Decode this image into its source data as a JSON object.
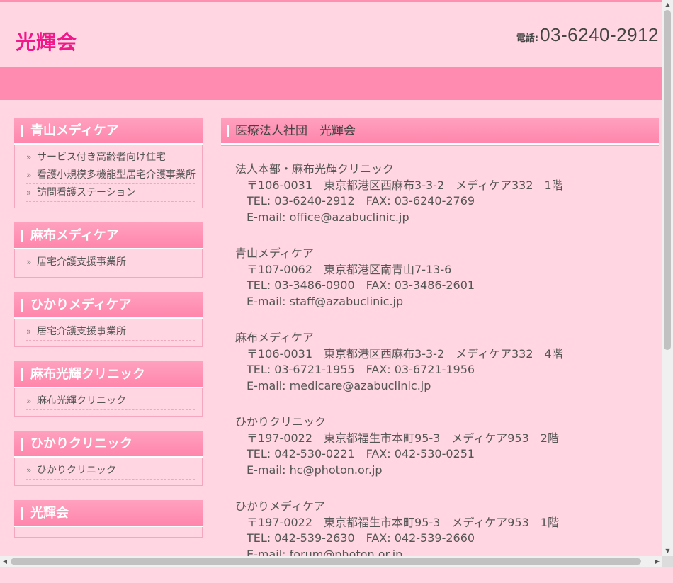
{
  "header": {
    "logo": "光輝会",
    "phone_label": "電話:",
    "phone_number": "03-6240-2912"
  },
  "sidebar": [
    {
      "title": "青山メディケア",
      "items": [
        "サービス付き高齢者向け住宅",
        "看護小規模多機能型居宅介護事業所",
        "訪問看護ステーション"
      ]
    },
    {
      "title": "麻布メディケア",
      "items": [
        "居宅介護支援事業所"
      ]
    },
    {
      "title": "ひかりメディケア",
      "items": [
        "居宅介護支援事業所"
      ]
    },
    {
      "title": "麻布光輝クリニック",
      "items": [
        "麻布光輝クリニック"
      ]
    },
    {
      "title": "ひかりクリニック",
      "items": [
        "ひかりクリニック"
      ]
    },
    {
      "title": "光輝会",
      "items": []
    }
  ],
  "main": {
    "title": "医療法人社団　光輝会",
    "entries": [
      {
        "name": "法人本部・麻布光輝クリニック",
        "address": "〒106-0031　東京都港区西麻布3-3-2　メディケア332　1階",
        "tel": "TEL: 03-6240-2912　FAX: 03-6240-2769",
        "email": "E-mail: office@azabuclinic.jp"
      },
      {
        "name": "青山メディケア",
        "address": "〒107-0062　東京都港区南青山7-13-6",
        "tel": "TEL: 03-3486-0900　FAX: 03-3486-2601",
        "email": "E-mail: staff@azabuclinic.jp"
      },
      {
        "name": "麻布メディケア",
        "address": "〒106-0031　東京都港区西麻布3-3-2　メディケア332　4階",
        "tel": "TEL: 03-6721-1955　FAX: 03-6721-1956",
        "email": "E-mail: medicare@azabuclinic.jp"
      },
      {
        "name": "ひかりクリニック",
        "address": "〒197-0022　東京都福生市本町95-3　メディケア953　2階",
        "tel": "TEL: 042-530-0221　FAX: 042-530-0251",
        "email": "E-mail: hc@photon.or.jp"
      },
      {
        "name": "ひかりメディケア",
        "address": "〒197-0022　東京都福生市本町95-3　メディケア953　1階",
        "tel": "TEL: 042-539-2630　FAX: 042-539-2660",
        "email": "E-mail: forum@photon.or.jp"
      }
    ]
  },
  "scrollbar": {
    "up": "▲",
    "down": "▼",
    "left": "◀",
    "right": "▶"
  }
}
